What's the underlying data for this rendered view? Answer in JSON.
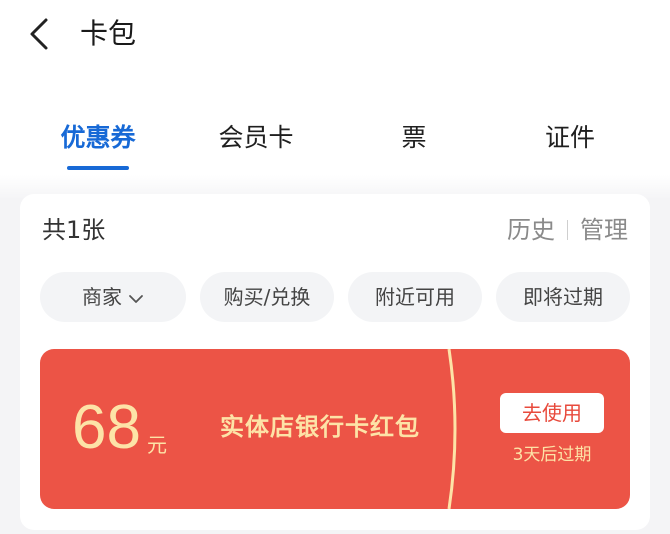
{
  "header": {
    "title": "卡包",
    "back_icon": "chevron-left-icon"
  },
  "tabs": [
    {
      "label": "优惠券",
      "active": true
    },
    {
      "label": "会员卡",
      "active": false
    },
    {
      "label": "票",
      "active": false
    },
    {
      "label": "证件",
      "active": false
    }
  ],
  "summary": {
    "count_text": "共1张",
    "history_label": "历史",
    "manage_label": "管理"
  },
  "filters": [
    {
      "label": "商家",
      "has_dropdown": true
    },
    {
      "label": "购买/兑换",
      "has_dropdown": false
    },
    {
      "label": "附近可用",
      "has_dropdown": false
    },
    {
      "label": "即将过期",
      "has_dropdown": false
    }
  ],
  "coupon": {
    "amount": "68",
    "unit": "元",
    "name": "实体店银行卡红包",
    "use_label": "去使用",
    "expire_text": "3天后过期"
  },
  "colors": {
    "accent": "#1769d6",
    "coupon_bg": "#ec5446",
    "coupon_text": "#fde3a7",
    "chip_bg": "#f3f4f6"
  }
}
